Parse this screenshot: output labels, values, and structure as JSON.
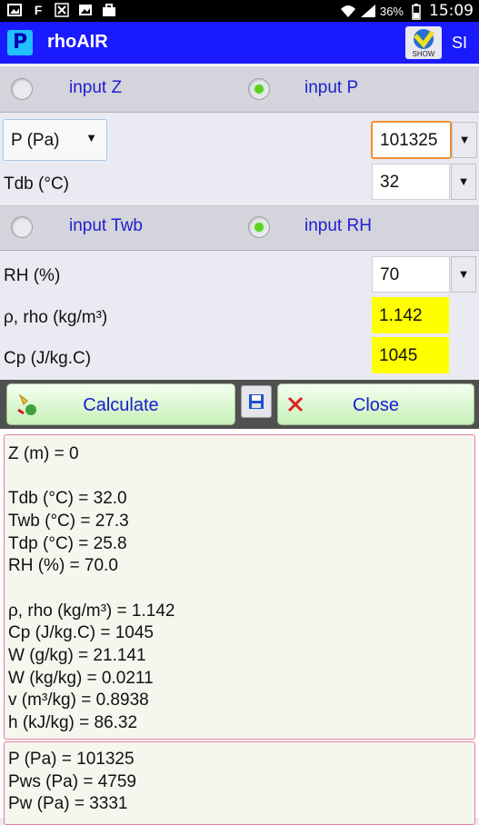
{
  "status_bar": {
    "icons": [
      "image-icon",
      "facebook-icon",
      "excel-icon",
      "picture-icon",
      "briefcase-icon"
    ],
    "battery": "36%",
    "time": "15:09"
  },
  "app": {
    "title": "rhoAIR",
    "logo_text": "P",
    "show_label": "SHOW",
    "units": "SI"
  },
  "row1": {
    "opt1": "input Z",
    "opt2": "input P",
    "selected": "opt2"
  },
  "row2": {
    "opt1": "input Twb",
    "opt2": "input RH",
    "selected": "opt2"
  },
  "form": {
    "pressure_select": "P (Pa)",
    "pressure_value": "101325",
    "tdb_label": "Tdb (°C)",
    "tdb_value": "32",
    "rh_label": "RH (%)",
    "rh_value": "70",
    "rho_label": "ρ, rho (kg/m³)",
    "rho_value": "1.142",
    "cp_label": "Cp (J/kg.C)",
    "cp_value": "1045"
  },
  "buttons": {
    "calculate": "Calculate",
    "close": "Close"
  },
  "results": {
    "box1": [
      "Z (m) = 0",
      "",
      "Tdb (°C) = 32.0",
      "Twb (°C) = 27.3",
      "Tdp (°C) = 25.8",
      "RH (%) = 70.0",
      "",
      "ρ, rho (kg/m³) = 1.142",
      "Cp (J/kg.C) = 1045",
      "W (g/kg) = 21.141",
      "W (kg/kg) = 0.0211",
      "v (m³/kg) = 0.8938",
      "h (kJ/kg) = 86.32"
    ],
    "box2": [
      "P (Pa) = 101325",
      "Pws (Pa) = 4759",
      "Pw (Pa) = 3331"
    ]
  },
  "colors": {
    "titlebar": "#1a1aff",
    "radio_text": "#2020d0",
    "highlight": "#ffff00",
    "focus_border": "#f09030"
  }
}
